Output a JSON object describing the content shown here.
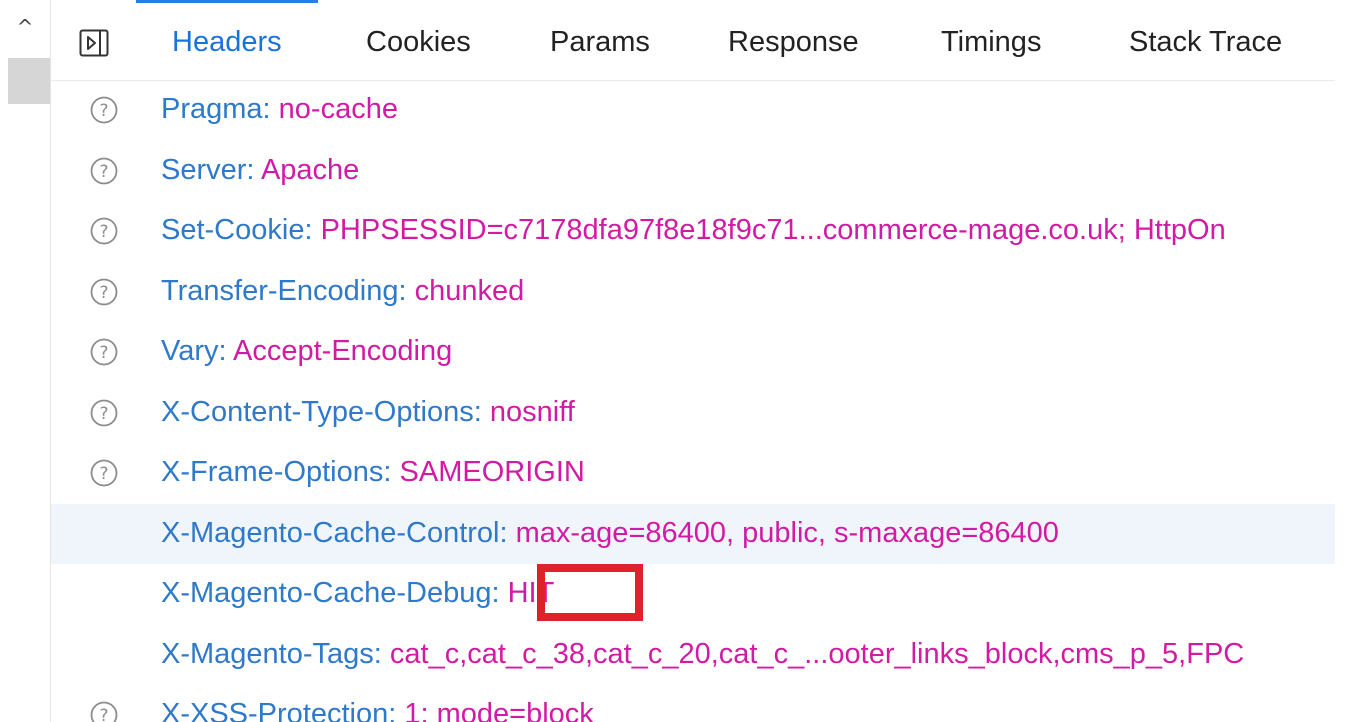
{
  "scroll": {
    "up_arrow": "^"
  },
  "tabs": [
    {
      "label": "Headers",
      "active": true
    },
    {
      "label": "Cookies",
      "active": false
    },
    {
      "label": "Params",
      "active": false
    },
    {
      "label": "Response",
      "active": false
    },
    {
      "label": "Timings",
      "active": false
    },
    {
      "label": "Stack Trace",
      "active": false
    }
  ],
  "headers": [
    {
      "name": "Pragma:",
      "value": "no-cache",
      "has_help": true
    },
    {
      "name": "Server:",
      "value": "Apache",
      "has_help": true
    },
    {
      "name": "Set-Cookie:",
      "value": "PHPSESSID=c7178dfa97f8e18f9c71...commerce-mage.co.uk; HttpOn",
      "has_help": true
    },
    {
      "name": "Transfer-Encoding:",
      "value": "chunked",
      "has_help": true
    },
    {
      "name": "Vary:",
      "value": "Accept-Encoding",
      "has_help": true
    },
    {
      "name": "X-Content-Type-Options:",
      "value": "nosniff",
      "has_help": true
    },
    {
      "name": "X-Frame-Options:",
      "value": "SAMEORIGIN",
      "has_help": true
    },
    {
      "name": "X-Magento-Cache-Control:",
      "value": "max-age=86400, public, s-maxage=86400",
      "has_help": false
    },
    {
      "name": "X-Magento-Cache-Debug:",
      "value": "HIT",
      "has_help": false
    },
    {
      "name": "X-Magento-Tags:",
      "value": "cat_c,cat_c_38,cat_c_20,cat_c_...ooter_links_block,cms_p_5,FPC",
      "has_help": false
    },
    {
      "name": "X-XSS-Protection:",
      "value": "1; mode=block",
      "has_help": true
    }
  ],
  "colors": {
    "header_name": "#2e79c9",
    "header_value": "#d21ba5",
    "active_tab": "#1a73d9",
    "annotation_box": "#e0202a",
    "row_highlight": "#f0f5fb"
  }
}
